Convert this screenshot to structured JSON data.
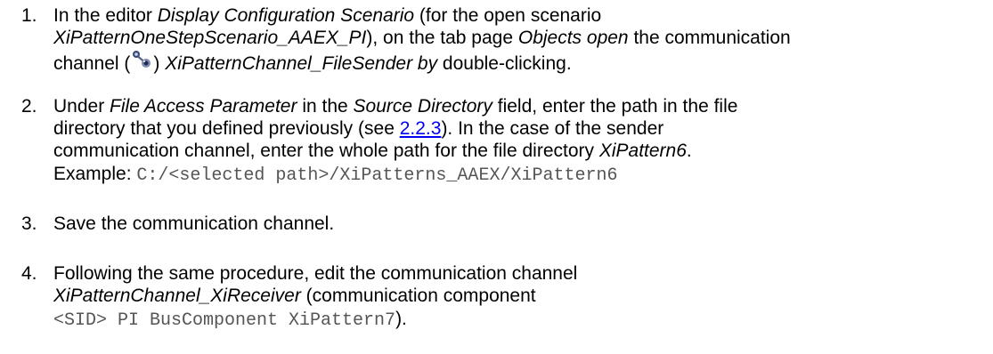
{
  "steps": [
    {
      "number": "1.",
      "l1_a": "In the editor ",
      "l1_b": "Display Configuration Scenario",
      "l1_c": " (for the open scenario",
      "l2_a": "XiPatternOneStepScenario_AAEX_PI",
      "l2_b": "), on the tab page ",
      "l2_c": "Objects open",
      "l2_d": " the communication",
      "l3_a": "channel (",
      "l3_b": ") ",
      "l3_c": "XiPatternChannel_FileSender by",
      "l3_d": " double-clicking.",
      "icon": "communication-channel-icon"
    },
    {
      "number": "2.",
      "l1_a": "Under ",
      "l1_b": "File Access Parameter",
      "l1_c": " in the ",
      "l1_d": "Source Directory",
      "l1_e": " field, enter the path in the file",
      "l2_a": "directory that you defined previously (see ",
      "l2_link": "2.2.3",
      "l2_b": "). In the case of the sender",
      "l3_a": "communication channel, enter the whole path for the file directory ",
      "l3_b": "XiPattern6",
      "l3_c": ".",
      "l4_a": "Example: ",
      "l4_code": "C:/<selected path>/XiPatterns_AAEX/XiPattern6"
    },
    {
      "number": "3.",
      "l1_a": "Save the communication channel."
    },
    {
      "number": "4.",
      "l1_a": "Following the same procedure, edit the communication channel",
      "l2_a": "XiPatternChannel_XiReceiver",
      "l2_b": " (communication component",
      "l3_code": "<SID> PI BusComponent XiPattern7",
      "l3_b": ")."
    }
  ],
  "colors": {
    "text": "#000000",
    "link": "#0000ee",
    "code": "#555555"
  }
}
